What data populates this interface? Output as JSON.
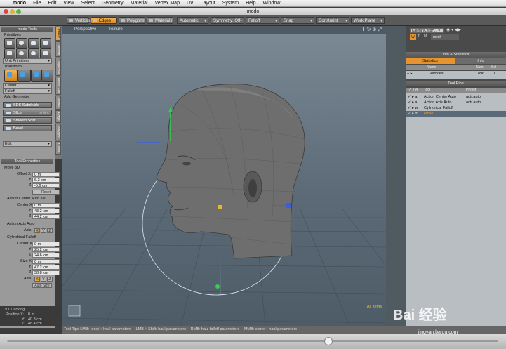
{
  "menubar": {
    "app": "modo",
    "items": [
      "File",
      "Edit",
      "View",
      "Select",
      "Geometry",
      "Material",
      "Vertex Map",
      "UV",
      "Layout",
      "System",
      "Help",
      "Window"
    ]
  },
  "window": {
    "title": "modo"
  },
  "toolbar": {
    "modes": [
      {
        "label": "Vertices",
        "selected": false
      },
      {
        "label": "Edges",
        "selected": true
      },
      {
        "label": "Polygons",
        "selected": false
      },
      {
        "label": "Materials",
        "selected": false
      }
    ],
    "dropdowns": [
      "Automatic",
      "Symmetry: Off",
      "Falloff",
      "Snap",
      "Constraint",
      "Work Plane"
    ]
  },
  "left_panel": {
    "header": "modo Tools",
    "primitives_label": "Primitives",
    "unit_primitives": "Unit Primitives",
    "transform_label": "Transform",
    "center_dropdown": "Center",
    "falloff_dropdown": "Falloff",
    "add_geometry_label": "Add Geometry",
    "geometry_buttons": [
      {
        "label": "SDS Subdivide",
        "shortcut": ""
      },
      {
        "label": "Slice",
        "shortcut": "Shift-C"
      },
      {
        "label": "Smooth Shift",
        "shortcut": ""
      },
      {
        "label": "Bevel",
        "shortcut": ""
      }
    ],
    "edit_dropdown": "Edit",
    "vertical_tabs": [
      "Basic",
      "Deform",
      "Duplicate",
      "Mesh Edit",
      "Vertex",
      "Edge",
      "Polygon",
      "Curve"
    ]
  },
  "tool_properties": {
    "header": "Tool Properties",
    "move_label": "Move 3D",
    "offset_label": "Offset X",
    "offset": {
      "x": "0 m",
      "y": "6.2 cm",
      "z": "-5.6 cm"
    },
    "reset_label": "Reset",
    "action_center_label": "Action Center Auto 3D",
    "center_label": "Center X",
    "center": {
      "x": "0 m",
      "y": "48.2 cm",
      "z": "44.2 cm"
    },
    "action_axis_label": "Action Axis Auto",
    "axis_label": "Axis",
    "axis_options": [
      "X",
      "Y",
      "Z"
    ],
    "axis_selected": "X",
    "cyl_falloff_label": "Cylindrical Falloff",
    "cyl_center_label": "Center X",
    "cyl_center": {
      "x": "0 m",
      "y": "25.2 cm",
      "z": "24.6 cm"
    },
    "size_label": "Size X",
    "size": {
      "x": "0 m",
      "y": "47.2 cm",
      "z": "38.8 cm"
    },
    "auto_size": "Auto Size",
    "axis2_label": "Axis",
    "axis2_selected": "X"
  },
  "tracking": {
    "title": "3D Tracking",
    "x_label": "Position X:",
    "x_value": "0 m",
    "y_label": "Y:",
    "y_value": "40.8 cm",
    "z_label": "Z:",
    "z_value": "48.4 cm"
  },
  "viewport": {
    "tabs": [
      "Perspective",
      "Texture"
    ],
    "corner_label": "All Items",
    "icons": [
      "crosshair-icon",
      "rotate-icon",
      "zoom-icon",
      "maximize-icon"
    ]
  },
  "status_bar": {
    "text": "Tool Tips    LMB: reset + haul parameters  --  LMB + Shift: haul parameters  --  RMB: haul falloff parameters  --  MMB: clone + haul parameters"
  },
  "right_panel": {
    "item_dropdown": "KajetanChildH... ▾",
    "icons_row": "◉ ▾ ◀▶",
    "tabs_row": [
      "W",
      "T",
      "M",
      "mesh"
    ],
    "info_header": "Info & Statistics",
    "info_tabs": [
      {
        "label": "Statistics",
        "selected": true
      },
      {
        "label": "Info",
        "selected": false
      }
    ],
    "stats_columns": [
      "Name",
      "Num",
      "Sel"
    ],
    "stats_rows": [
      {
        "name": "Vertices",
        "num": "1896",
        "sel": "0"
      }
    ],
    "toolpipe_header": "Tool Pipe",
    "toolpipe_columns": [
      "Tool",
      "Preset"
    ],
    "toolpipe_rows": [
      {
        "tool": "Action Center Auto",
        "preset": "actr.auto",
        "selected": false
      },
      {
        "tool": "Action Axis Auto",
        "preset": "actr.auto",
        "selected": false
      },
      {
        "tool": "Cylindrical Falloff",
        "preset": "",
        "selected": false
      },
      {
        "tool": "Move",
        "preset": "",
        "selected": true
      }
    ]
  },
  "watermark": {
    "text": "Bai 经验",
    "url": "jingyan.baidu.com"
  },
  "colors": {
    "accent": "#e6952e",
    "viewport_top": "#7b8a95",
    "viewport_bottom": "#4d5c67",
    "panel": "#9a9a9a"
  }
}
